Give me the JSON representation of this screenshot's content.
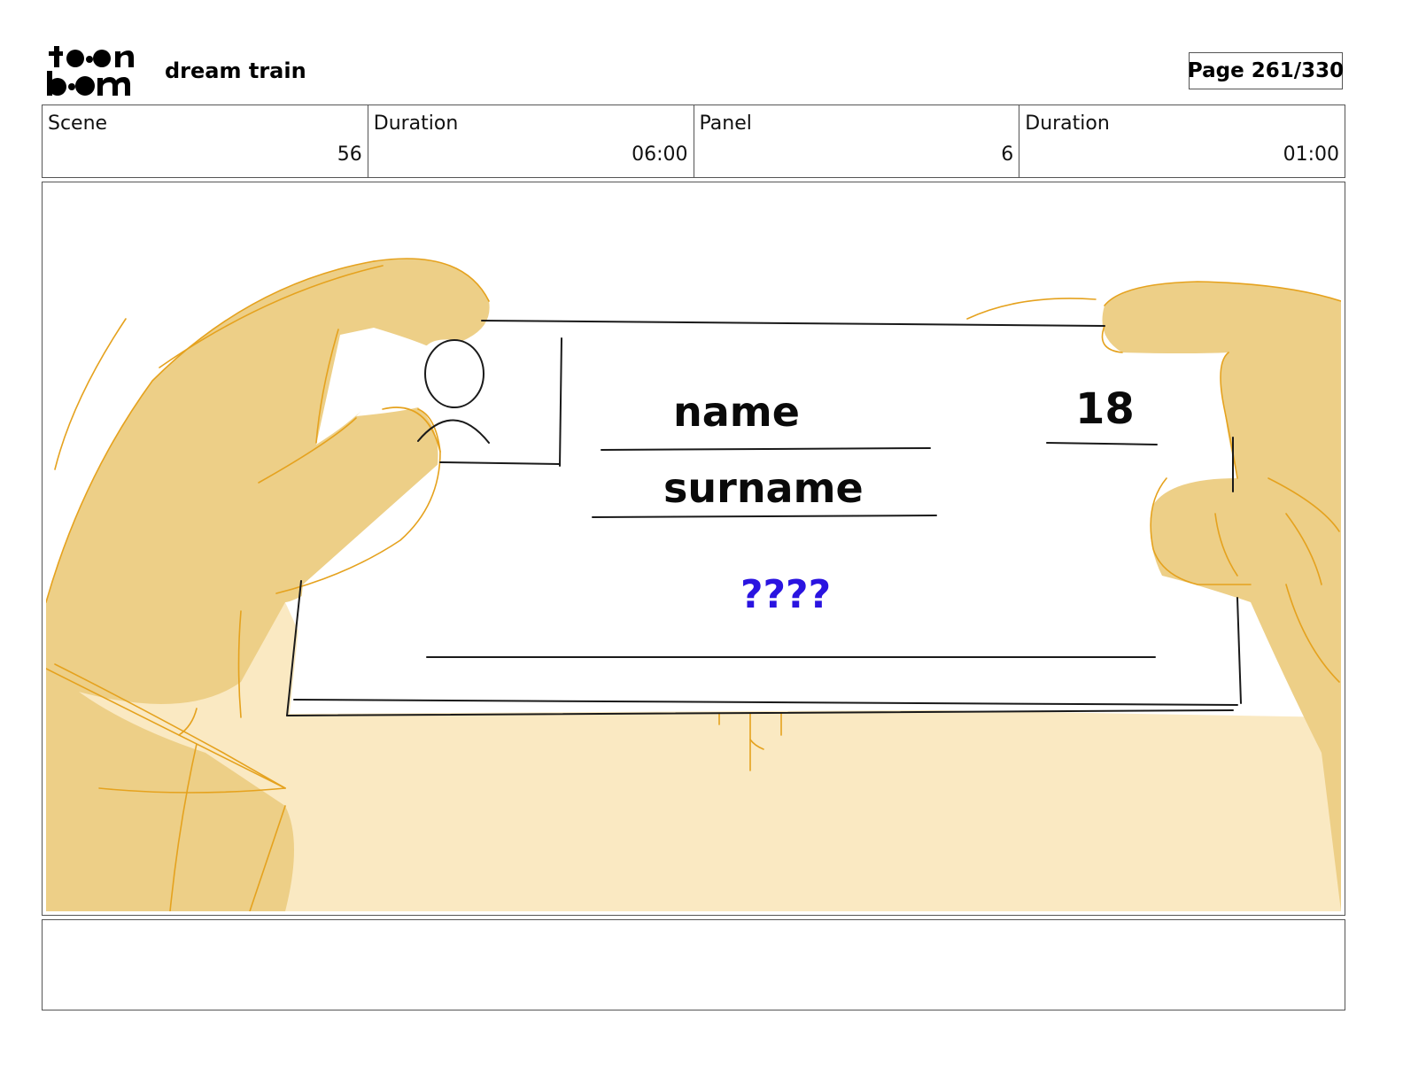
{
  "header": {
    "logo_name": "toon boom",
    "project_title": "dream train",
    "page_label": "Page 261/330"
  },
  "info": {
    "scene_label": "Scene",
    "scene_value": "56",
    "scene_duration_label": "Duration",
    "scene_duration_value": "06:00",
    "panel_label": "Panel",
    "panel_value": "6",
    "panel_duration_label": "Duration",
    "panel_duration_value": "01:00"
  },
  "panel": {
    "card": {
      "name_text": "name",
      "surname_text": "surname",
      "number_text": "18",
      "question_text": "????"
    },
    "colors": {
      "skin": "#EDCF87",
      "skin_light": "#FAE9C2",
      "sketch_line": "#E5A21E",
      "card_line": "#1A1A1A",
      "question": "#2A14E0"
    }
  },
  "notes": {
    "text": ""
  }
}
